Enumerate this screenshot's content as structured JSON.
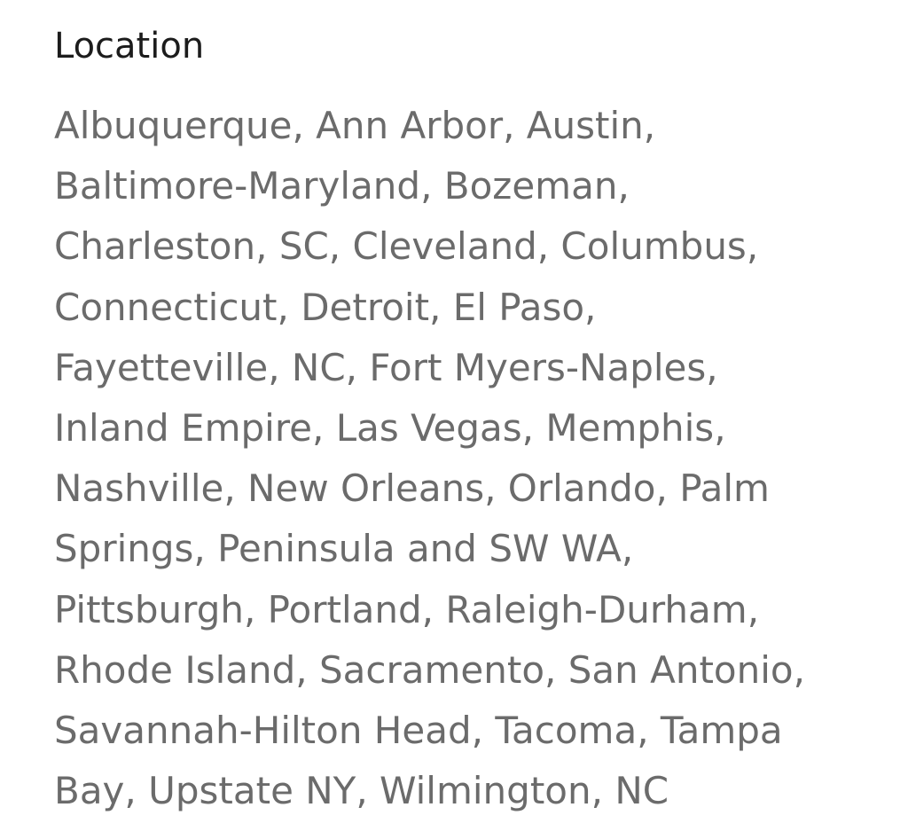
{
  "section": {
    "title": "Location",
    "lines": [
      "Albuquerque, Ann Arbor, Austin,",
      "Baltimore-Maryland, Bozeman,",
      "Charleston, SC, Cleveland, Columbus,",
      "Connecticut, Detroit, El Paso,",
      "Fayetteville, NC, Fort Myers-Naples,",
      "Inland Empire, Las Vegas, Memphis,",
      "Nashville, New Orleans, Orlando, Palm",
      "Springs, Peninsula and SW WA,",
      "Pittsburgh, Portland, Raleigh-Durham,",
      "Rhode Island, Sacramento, San Antonio,",
      "Savannah-Hilton Head, Tacoma, Tampa",
      "Bay, Upstate NY, Wilmington, NC"
    ]
  }
}
